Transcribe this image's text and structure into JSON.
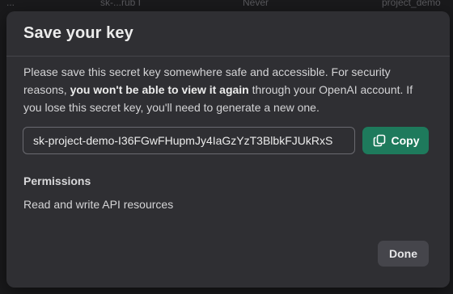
{
  "background_row": {
    "col1": "...",
    "col2": "sk-...rub I",
    "col3": "Never",
    "col4": "project_demo"
  },
  "modal": {
    "title": "Save your key",
    "description": {
      "part1": "Please save this secret key somewhere safe and accessible. For security reasons, ",
      "emphasis": "you won't be able to view it again",
      "part2": " through your OpenAI account. If you lose this secret key, you'll need to generate a new one."
    },
    "secret_key": "sk-project-demo-I36FGwFHupmJy4IaGzYzT3BlbkFJUkRxS",
    "copy_button": {
      "label": "Copy",
      "icon": "copy-icon"
    },
    "permissions": {
      "label": "Permissions",
      "value": "Read and write API resources"
    },
    "done_button": {
      "label": "Done"
    }
  },
  "colors": {
    "accent": "#1e7a5c",
    "modal_background": "#2f2f33",
    "page_background": "#1a1a1c",
    "text": "#ececec"
  }
}
